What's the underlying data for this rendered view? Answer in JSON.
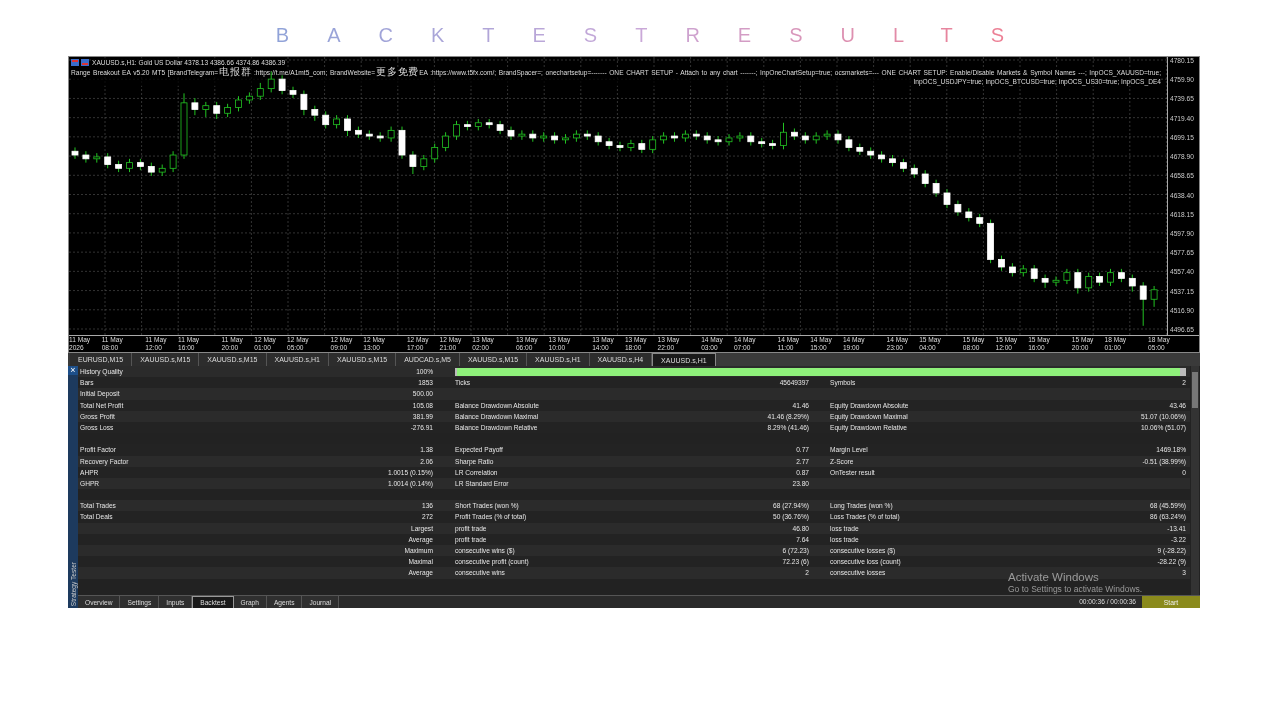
{
  "page_title": "BACKTESTRESULTS",
  "chart": {
    "symbol_line": "XAUUSD.s,H1:  Gold US Dollar  4378.13 4386.66 4374.86 4386.39",
    "ea_line": [
      {
        "kind": "latin",
        "text": "Range Breakout EA v5.20 MT5 [BrandTelegram="
      },
      {
        "kind": "cjk",
        "text": "电报群"
      },
      {
        "kind": "latin",
        "text": " :https://t.me/A1mt5_com; BrandWebsite="
      },
      {
        "kind": "cjk",
        "text": "更多免费"
      },
      {
        "kind": "latin",
        "text": "EA :https://www.t5fx.com/; BrandSpacer=; onechartsetup=------- ONE CHART SETUP - Attach to any chart -------; InpOneChartSetup=true; ocsmarkets=--- ONE CHART SETUP: Enable/Disable Markets & Symbol Names ---; InpOCS_XAUUSD=true; InpOCS_USDJPY=true; InpOCS_BTCUSD=true; InpOCS_US30=true; InpOCS_DE4"
      }
    ],
    "chart_data": {
      "type": "candlestick",
      "categories": [
        "11 May 2026",
        null,
        null,
        "11 May 08:00",
        null,
        null,
        null,
        "11 May 12:00",
        null,
        null,
        "11 May 16:00",
        null,
        null,
        null,
        "11 May 20:00",
        null,
        null,
        "12 May 01:00",
        null,
        null,
        "12 May 05:00",
        null,
        null,
        null,
        "12 May 09:00",
        null,
        null,
        "12 May 13:00",
        null,
        null,
        null,
        "12 May 17:00",
        null,
        null,
        "12 May 21:00",
        null,
        null,
        "13 May 02:00",
        null,
        null,
        null,
        "13 May 06:00",
        null,
        null,
        "13 May 10:00",
        null,
        null,
        null,
        "13 May 14:00",
        null,
        null,
        "13 May 18:00",
        null,
        null,
        "13 May 22:00",
        null,
        null,
        null,
        "14 May 03:00",
        null,
        null,
        "14 May 07:00",
        null,
        null,
        null,
        "14 May 11:00",
        null,
        null,
        "14 May 15:00",
        null,
        null,
        "14 May 19:00",
        null,
        null,
        null,
        "14 May 23:00",
        null,
        null,
        "15 May 04:00",
        null,
        null,
        null,
        "15 May 08:00",
        null,
        null,
        "15 May 12:00",
        null,
        null,
        "15 May 16:00",
        null,
        null,
        null,
        "15 May 20:00",
        null,
        null,
        "18 May 01:00",
        null,
        null,
        null,
        "18 May 05:00"
      ],
      "ohlc": [
        [
          4684,
          4688,
          4676,
          4680
        ],
        [
          4680,
          4684,
          4672,
          4676
        ],
        [
          4676,
          4682,
          4672,
          4678
        ],
        [
          4678,
          4682,
          4666,
          4670
        ],
        [
          4670,
          4674,
          4662,
          4666
        ],
        [
          4666,
          4676,
          4662,
          4672
        ],
        [
          4672,
          4676,
          4664,
          4668
        ],
        [
          4668,
          4672,
          4658,
          4662
        ],
        [
          4662,
          4670,
          4658,
          4666
        ],
        [
          4666,
          4684,
          4662,
          4680
        ],
        [
          4680,
          4745,
          4676,
          4735
        ],
        [
          4735,
          4740,
          4722,
          4728
        ],
        [
          4728,
          4736,
          4720,
          4732
        ],
        [
          4732,
          4736,
          4718,
          4724
        ],
        [
          4724,
          4734,
          4720,
          4730
        ],
        [
          4730,
          4742,
          4726,
          4738
        ],
        [
          4738,
          4746,
          4734,
          4742
        ],
        [
          4742,
          4756,
          4738,
          4750
        ],
        [
          4750,
          4768,
          4746,
          4760
        ],
        [
          4760,
          4764,
          4744,
          4748
        ],
        [
          4748,
          4752,
          4740,
          4744
        ],
        [
          4744,
          4748,
          4722,
          4728
        ],
        [
          4728,
          4732,
          4716,
          4722
        ],
        [
          4722,
          4726,
          4708,
          4712
        ],
        [
          4712,
          4722,
          4708,
          4718
        ],
        [
          4718,
          4722,
          4700,
          4706
        ],
        [
          4706,
          4710,
          4698,
          4702
        ],
        [
          4702,
          4706,
          4696,
          4700
        ],
        [
          4700,
          4704,
          4694,
          4698
        ],
        [
          4698,
          4710,
          4694,
          4706
        ],
        [
          4706,
          4710,
          4676,
          4680
        ],
        [
          4680,
          4684,
          4660,
          4668
        ],
        [
          4668,
          4680,
          4664,
          4676
        ],
        [
          4676,
          4692,
          4672,
          4688
        ],
        [
          4688,
          4704,
          4684,
          4700
        ],
        [
          4700,
          4716,
          4696,
          4712
        ],
        [
          4712,
          4716,
          4706,
          4710
        ],
        [
          4710,
          4718,
          4706,
          4714
        ],
        [
          4714,
          4718,
          4708,
          4712
        ],
        [
          4712,
          4716,
          4702,
          4706
        ],
        [
          4706,
          4710,
          4696,
          4700
        ],
        [
          4700,
          4706,
          4696,
          4702
        ],
        [
          4702,
          4706,
          4694,
          4698
        ],
        [
          4698,
          4704,
          4694,
          4700
        ],
        [
          4700,
          4704,
          4692,
          4696
        ],
        [
          4696,
          4702,
          4692,
          4698
        ],
        [
          4698,
          4706,
          4694,
          4702
        ],
        [
          4702,
          4706,
          4696,
          4700
        ],
        [
          4700,
          4704,
          4690,
          4694
        ],
        [
          4694,
          4698,
          4686,
          4690
        ],
        [
          4690,
          4694,
          4684,
          4688
        ],
        [
          4688,
          4696,
          4684,
          4692
        ],
        [
          4692,
          4696,
          4682,
          4686
        ],
        [
          4686,
          4700,
          4682,
          4696
        ],
        [
          4696,
          4704,
          4692,
          4700
        ],
        [
          4700,
          4704,
          4694,
          4698
        ],
        [
          4698,
          4706,
          4694,
          4702
        ],
        [
          4702,
          4706,
          4696,
          4700
        ],
        [
          4700,
          4704,
          4692,
          4696
        ],
        [
          4696,
          4700,
          4690,
          4694
        ],
        [
          4694,
          4702,
          4690,
          4698
        ],
        [
          4698,
          4704,
          4694,
          4700
        ],
        [
          4700,
          4704,
          4690,
          4694
        ],
        [
          4694,
          4698,
          4688,
          4692
        ],
        [
          4692,
          4696,
          4686,
          4690
        ],
        [
          4690,
          4714,
          4686,
          4704
        ],
        [
          4704,
          4708,
          4696,
          4700
        ],
        [
          4700,
          4704,
          4692,
          4696
        ],
        [
          4696,
          4704,
          4692,
          4700
        ],
        [
          4700,
          4706,
          4696,
          4702
        ],
        [
          4702,
          4706,
          4692,
          4696
        ],
        [
          4696,
          4700,
          4684,
          4688
        ],
        [
          4688,
          4692,
          4680,
          4684
        ],
        [
          4684,
          4688,
          4676,
          4680
        ],
        [
          4680,
          4684,
          4672,
          4676
        ],
        [
          4676,
          4680,
          4668,
          4672
        ],
        [
          4672,
          4676,
          4662,
          4666
        ],
        [
          4666,
          4670,
          4656,
          4660
        ],
        [
          4660,
          4664,
          4646,
          4650
        ],
        [
          4650,
          4654,
          4636,
          4640
        ],
        [
          4640,
          4644,
          4624,
          4628
        ],
        [
          4628,
          4632,
          4616,
          4620
        ],
        [
          4620,
          4624,
          4610,
          4614
        ],
        [
          4614,
          4618,
          4604,
          4608
        ],
        [
          4608,
          4612,
          4566,
          4570
        ],
        [
          4570,
          4574,
          4558,
          4562
        ],
        [
          4562,
          4566,
          4552,
          4556
        ],
        [
          4556,
          4564,
          4552,
          4560
        ],
        [
          4560,
          4564,
          4546,
          4550
        ],
        [
          4550,
          4554,
          4540,
          4546
        ],
        [
          4546,
          4552,
          4542,
          4548
        ],
        [
          4548,
          4560,
          4544,
          4556
        ],
        [
          4556,
          4560,
          4534,
          4540
        ],
        [
          4540,
          4556,
          4536,
          4552
        ],
        [
          4552,
          4556,
          4542,
          4546
        ],
        [
          4546,
          4560,
          4542,
          4556
        ],
        [
          4556,
          4560,
          4546,
          4550
        ],
        [
          4550,
          4554,
          4536,
          4542
        ],
        [
          4542,
          4546,
          4500,
          4528
        ],
        [
          4528,
          4542,
          4520,
          4538
        ]
      ],
      "ylim": [
        4496.65,
        4780.15
      ],
      "grid": true,
      "yticks": [
        {
          "value": 4780.15,
          "label": "4780.15"
        },
        {
          "value": 4759.9,
          "label": "4759.90"
        },
        {
          "value": 4739.65,
          "label": "4739.65"
        },
        {
          "value": 4719.4,
          "label": "4719.40"
        },
        {
          "value": 4699.15,
          "label": "4699.15"
        },
        {
          "value": 4678.9,
          "label": "4678.90"
        },
        {
          "value": 4658.65,
          "label": "4658.65"
        },
        {
          "value": 4638.4,
          "label": "4638.40"
        },
        {
          "value": 4618.15,
          "label": "4618.15"
        },
        {
          "value": 4597.9,
          "label": "4597.90"
        },
        {
          "value": 4577.65,
          "label": "4577.65"
        },
        {
          "value": 4557.4,
          "label": "4557.40"
        },
        {
          "value": 4537.15,
          "label": "4537.15"
        },
        {
          "value": 4516.9,
          "label": "4516.90"
        },
        {
          "value": 4496.65,
          "label": "4496.65"
        }
      ]
    }
  },
  "chart_tabs": [
    {
      "label": "EURUSD,M15",
      "selected": false
    },
    {
      "label": "XAUUSD.s,M15",
      "selected": false
    },
    {
      "label": "XAUUSD.s,M15",
      "selected": false
    },
    {
      "label": "XAUUSD.s,H1",
      "selected": false
    },
    {
      "label": "XAUUSD.s,M15",
      "selected": false
    },
    {
      "label": "AUDCAD.s,M5",
      "selected": false
    },
    {
      "label": "XAUUSD.s,M15",
      "selected": false
    },
    {
      "label": "XAUUSD.s,H1",
      "selected": false
    },
    {
      "label": "XAUUSD.s,H4",
      "selected": false
    },
    {
      "label": "XAUUSD.s,H1",
      "selected": true
    }
  ],
  "tester": {
    "side_label": "Strategy Tester",
    "close": "×",
    "rows": [
      {
        "kind": "quality",
        "column_1": "History Quality",
        "column_2": "100%",
        "level": 1
      },
      {
        "kind": "data",
        "column_1": "Bars",
        "column_2": "1853",
        "column_3": "Ticks",
        "column_4": "45649397",
        "column_5": "Symbols",
        "column_6": "2"
      },
      {
        "kind": "data",
        "column_1": "Initial Deposit",
        "column_2": "500.00"
      },
      {
        "kind": "data",
        "column_1": "Total Net Profit",
        "column_2": "105.08",
        "column_3": "Balance Drawdown Absolute",
        "column_4": "41.46",
        "column_5": "Equity Drawdown Absolute",
        "column_6": "43.46"
      },
      {
        "kind": "data",
        "column_1": "Gross Profit",
        "column_2": "381.99",
        "column_3": "Balance Drawdown Maximal",
        "column_4": "41.46 (8.29%)",
        "column_5": "Equity Drawdown Maximal",
        "column_6": "51.07 (10.06%)"
      },
      {
        "kind": "data",
        "column_1": "Gross Loss",
        "column_2": "-276.91",
        "column_3": "Balance Drawdown Relative",
        "column_4": "8.29% (41.46)",
        "column_5": "Equity Drawdown Relative",
        "column_6": "10.06% (51.07)"
      },
      {
        "kind": "blank"
      },
      {
        "kind": "data",
        "column_1": "Profit Factor",
        "column_2": "1.38",
        "column_3": "Expected Payoff",
        "column_4": "0.77",
        "column_5": "Margin Level",
        "column_6": "1469.18%"
      },
      {
        "kind": "data",
        "column_1": "Recovery Factor",
        "column_2": "2.06",
        "column_3": "Sharpe Ratio",
        "column_4": "2.77",
        "column_5": "Z-Score",
        "column_6": "-0.51 (38.99%)"
      },
      {
        "kind": "data",
        "column_1": "AHPR",
        "column_2": "1.0015 (0.15%)",
        "column_3": "LR Correlation",
        "column_4": "0.87",
        "column_5": "OnTester result",
        "column_6": "0"
      },
      {
        "kind": "data",
        "column_1": "GHPR",
        "column_2": "1.0014 (0.14%)",
        "column_3": "LR Standard Error",
        "column_4": "23.80"
      },
      {
        "kind": "blank"
      },
      {
        "kind": "data",
        "column_1": "Total Trades",
        "column_2": "136",
        "column_3": "Short Trades (won %)",
        "column_4": "68 (27.94%)",
        "column_5": "Long Trades (won %)",
        "column_6": "68 (45.59%)"
      },
      {
        "kind": "data",
        "column_1": "Total Deals",
        "column_2": "272",
        "column_3": "Profit Trades (% of total)",
        "column_4": "50 (36.76%)",
        "column_5": "Loss Trades (% of total)",
        "column_6": "86 (63.24%)"
      },
      {
        "kind": "data",
        "column_2": "Largest",
        "column_3": "profit trade",
        "column_4": "46.80",
        "column_5": "loss trade",
        "column_6": "-13.41"
      },
      {
        "kind": "data",
        "column_2": "Average",
        "column_3": "profit trade",
        "column_4": "7.64",
        "column_5": "loss trade",
        "column_6": "-3.22"
      },
      {
        "kind": "data",
        "column_2": "Maximum",
        "column_3": "consecutive wins ($)",
        "column_4": "6 (72.23)",
        "column_5": "consecutive losses ($)",
        "column_6": "9 (-28.22)"
      },
      {
        "kind": "data",
        "column_2": "Maximal",
        "column_3": "consecutive profit (count)",
        "column_4": "72.23 (6)",
        "column_5": "consecutive loss (count)",
        "column_6": "-28.22 (9)"
      },
      {
        "kind": "data",
        "column_2": "Average",
        "column_3": "consecutive wins",
        "column_4": "2",
        "column_5": "consecutive losses",
        "column_6": "3"
      },
      {
        "kind": "blank"
      }
    ],
    "tabs": [
      {
        "label": "Overview",
        "selected": false
      },
      {
        "label": "Settings",
        "selected": false
      },
      {
        "label": "Inputs",
        "selected": false
      },
      {
        "label": "Backtest",
        "selected": true
      },
      {
        "label": "Graph",
        "selected": false
      },
      {
        "label": "Agents",
        "selected": false
      },
      {
        "label": "Journal",
        "selected": false
      }
    ],
    "elapsed": "00:00:36 / 00:00:36",
    "start_button": "Start"
  },
  "os_notice": {
    "title": "Activate Windows",
    "subtitle": "Go to Settings to activate Windows."
  }
}
